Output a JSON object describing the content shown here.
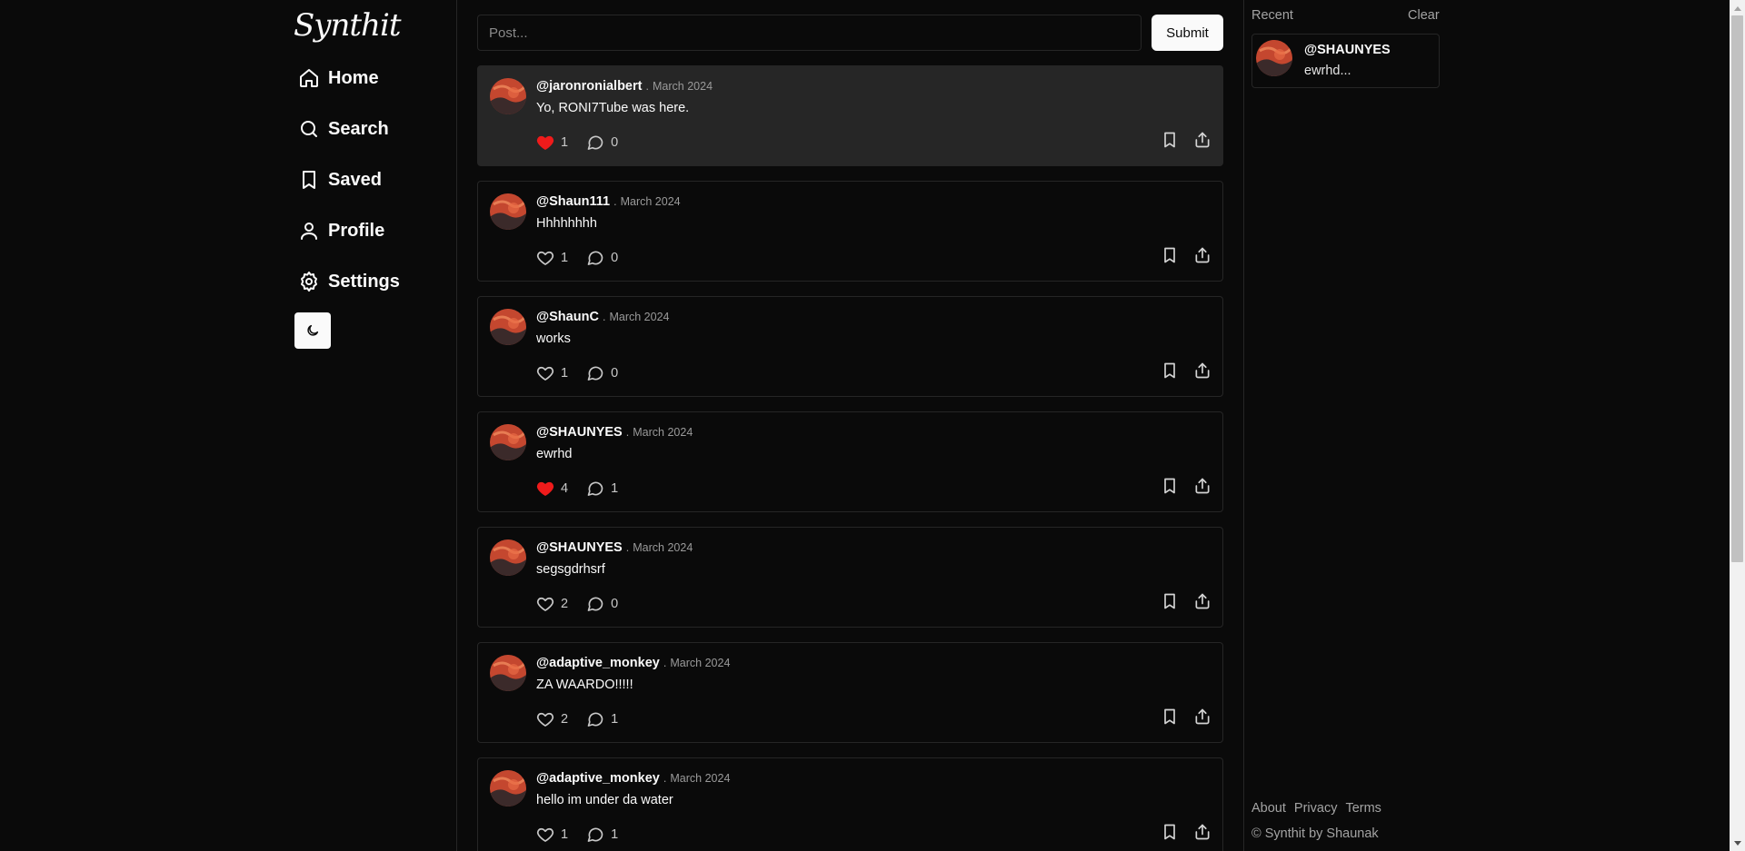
{
  "app": {
    "logo": "Synthit"
  },
  "nav": {
    "items": [
      {
        "label": "Home",
        "icon": "home-icon"
      },
      {
        "label": "Search",
        "icon": "search-icon"
      },
      {
        "label": "Saved",
        "icon": "bookmark-icon"
      },
      {
        "label": "Profile",
        "icon": "user-icon"
      },
      {
        "label": "Settings",
        "icon": "gear-icon"
      }
    ],
    "theme_toggle_icon": "moon-icon"
  },
  "composer": {
    "placeholder": "Post...",
    "submit_label": "Submit"
  },
  "colors": {
    "background": "#0a0a0a",
    "liked": "#ef1b1b",
    "highlight_card": "#262626",
    "border": "#262626"
  },
  "posts": [
    {
      "handle": "@jaronronialbert",
      "sep": ".",
      "date": "March 2024",
      "text": "Yo, RONI7Tube was here.",
      "likes": "1",
      "comments": "0",
      "liked": true,
      "highlighted": true
    },
    {
      "handle": "@Shaun111",
      "sep": ".",
      "date": "March 2024",
      "text": "Hhhhhhhh",
      "likes": "1",
      "comments": "0",
      "liked": false,
      "highlighted": false
    },
    {
      "handle": "@ShaunC",
      "sep": ".",
      "date": "March 2024",
      "text": "works",
      "likes": "1",
      "comments": "0",
      "liked": false,
      "highlighted": false
    },
    {
      "handle": "@SHAUNYES",
      "sep": ".",
      "date": "March 2024",
      "text": "ewrhd",
      "likes": "4",
      "comments": "1",
      "liked": true,
      "highlighted": false
    },
    {
      "handle": "@SHAUNYES",
      "sep": ".",
      "date": "March 2024",
      "text": "segsgdrhsrf",
      "likes": "2",
      "comments": "0",
      "liked": false,
      "highlighted": false
    },
    {
      "handle": "@adaptive_monkey",
      "sep": ".",
      "date": "March 2024",
      "text": "ZA WAARDO!!!!!",
      "likes": "2",
      "comments": "1",
      "liked": false,
      "highlighted": false
    },
    {
      "handle": "@adaptive_monkey",
      "sep": ".",
      "date": "March 2024",
      "text": "hello im under da water",
      "likes": "1",
      "comments": "1",
      "liked": false,
      "highlighted": false
    }
  ],
  "recent": {
    "label": "Recent",
    "clear_label": "Clear",
    "items": [
      {
        "handle": "@SHAUNYES",
        "text": "ewrhd..."
      }
    ]
  },
  "footer": {
    "links": [
      "About",
      "Privacy",
      "Terms"
    ],
    "copyright": "© Synthit by Shaunak"
  }
}
